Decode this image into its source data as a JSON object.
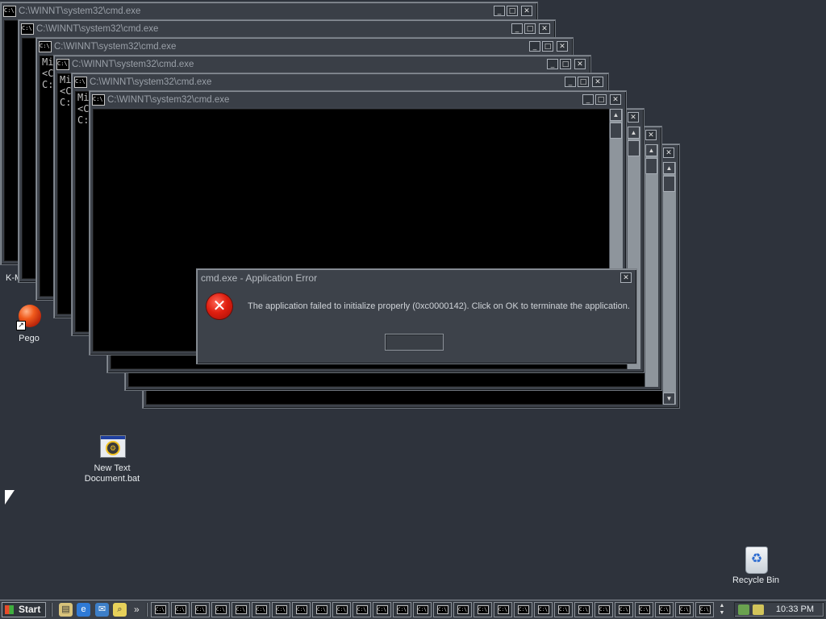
{
  "windows": [
    {
      "title": "C:\\WINNT\\system32\\cmd.exe",
      "lines": []
    },
    {
      "title": "C:\\WINNT\\system32\\cmd.exe",
      "lines": []
    },
    {
      "title": "C:\\WINNT\\system32\\cmd.exe",
      "lines": [
        "Mi",
        "<C",
        "",
        "C:"
      ]
    },
    {
      "title": "C:\\WINNT\\system32\\cmd.exe",
      "lines": [
        "Mi",
        "<C",
        "",
        "C:"
      ]
    },
    {
      "title": "C:\\WINNT\\system32\\cmd.exe",
      "lines": [
        "Mi",
        "<C",
        "",
        "C:"
      ]
    },
    {
      "title": "C:\\WINNT\\system32\\cmd.exe",
      "lines": []
    }
  ],
  "window_icon_text": "C:\\",
  "dialog": {
    "title": "cmd.exe - Application Error",
    "message": "The application failed to initialize properly (0xc0000142). Click on OK to terminate the application.",
    "ok_label": ""
  },
  "desktop_icons": {
    "partial_label": "K-M",
    "pego": "Pego",
    "bat_line1": "New Text",
    "bat_line2": "Document.bat",
    "recycle_bin": "Recycle Bin"
  },
  "taskbar": {
    "start_label": "Start",
    "chevron": "»",
    "button_count": 28,
    "clock": "10:33 PM"
  },
  "icons": {
    "minimize": "_",
    "maximize": "□",
    "close": "✕",
    "error": "✕",
    "up": "▲",
    "down": "▼"
  }
}
